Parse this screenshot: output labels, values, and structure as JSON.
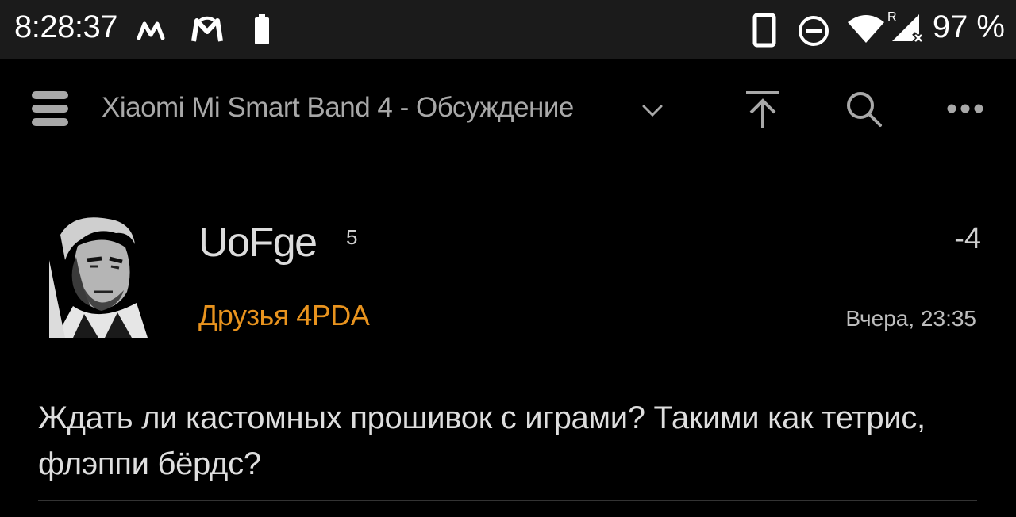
{
  "status_bar": {
    "time": "8:28:37",
    "battery_percent": "97 %",
    "icons": [
      "m-app-icon",
      "mi-fit-icon",
      "battery-small-icon",
      "phone-icon",
      "dnd-icon",
      "wifi-icon",
      "signal-roaming-icon"
    ],
    "signal_roaming_label": "R"
  },
  "toolbar": {
    "title": "Xiaomi Mi Smart Band 4 - Обсуждение",
    "icons": [
      "menu-icon",
      "chevron-down-icon",
      "scroll-top-icon",
      "search-icon",
      "more-icon"
    ]
  },
  "post": {
    "username": "UoFge",
    "reputation": "5",
    "rating": "-4",
    "group": "Друзья 4PDA",
    "date": "Вчера, 23:35",
    "body": "Ждать ли кастомных прошивок с играми? Такими как тетрис, флэппи бёрдс?"
  },
  "colors": {
    "background": "#000000",
    "status_bar": "#1b1b1b",
    "group_accent": "#e8931e",
    "username": "#dcdcdc"
  }
}
